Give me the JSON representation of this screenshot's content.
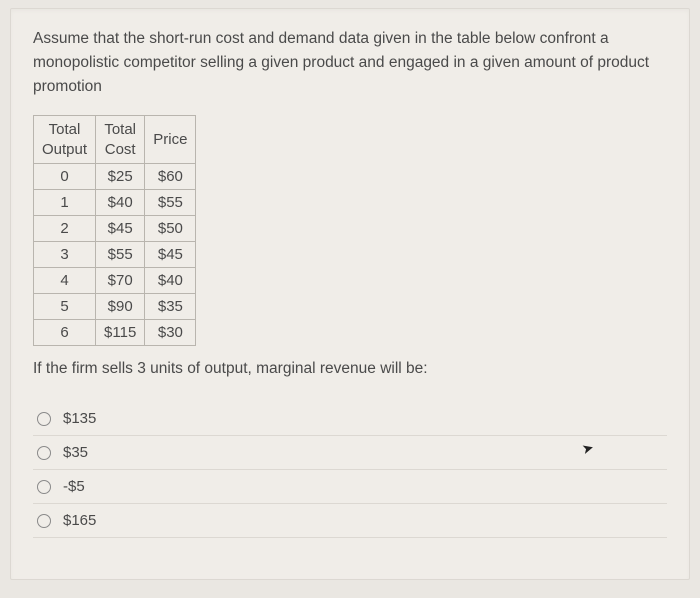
{
  "prompt": "Assume that the short-run cost and demand data given in the table below confront a monopolistic competitor selling a given product and engaged in a given amount of product promotion",
  "table": {
    "headers": {
      "c0": "Total Output",
      "c1": "Total Cost",
      "c2": "Price"
    },
    "rows": [
      {
        "output": "0",
        "cost": "$25",
        "price": "$60"
      },
      {
        "output": "1",
        "cost": "$40",
        "price": "$55"
      },
      {
        "output": "2",
        "cost": "$45",
        "price": "$50"
      },
      {
        "output": "3",
        "cost": "$55",
        "price": "$45"
      },
      {
        "output": "4",
        "cost": "$70",
        "price": "$40"
      },
      {
        "output": "5",
        "cost": "$90",
        "price": "$35"
      },
      {
        "output": "6",
        "cost": "$115",
        "price": "$30"
      }
    ]
  },
  "question": "If the firm sells 3 units of output, marginal revenue will be:",
  "options": [
    {
      "label": "$135"
    },
    {
      "label": "$35"
    },
    {
      "label": "-$5"
    },
    {
      "label": "$165"
    }
  ]
}
